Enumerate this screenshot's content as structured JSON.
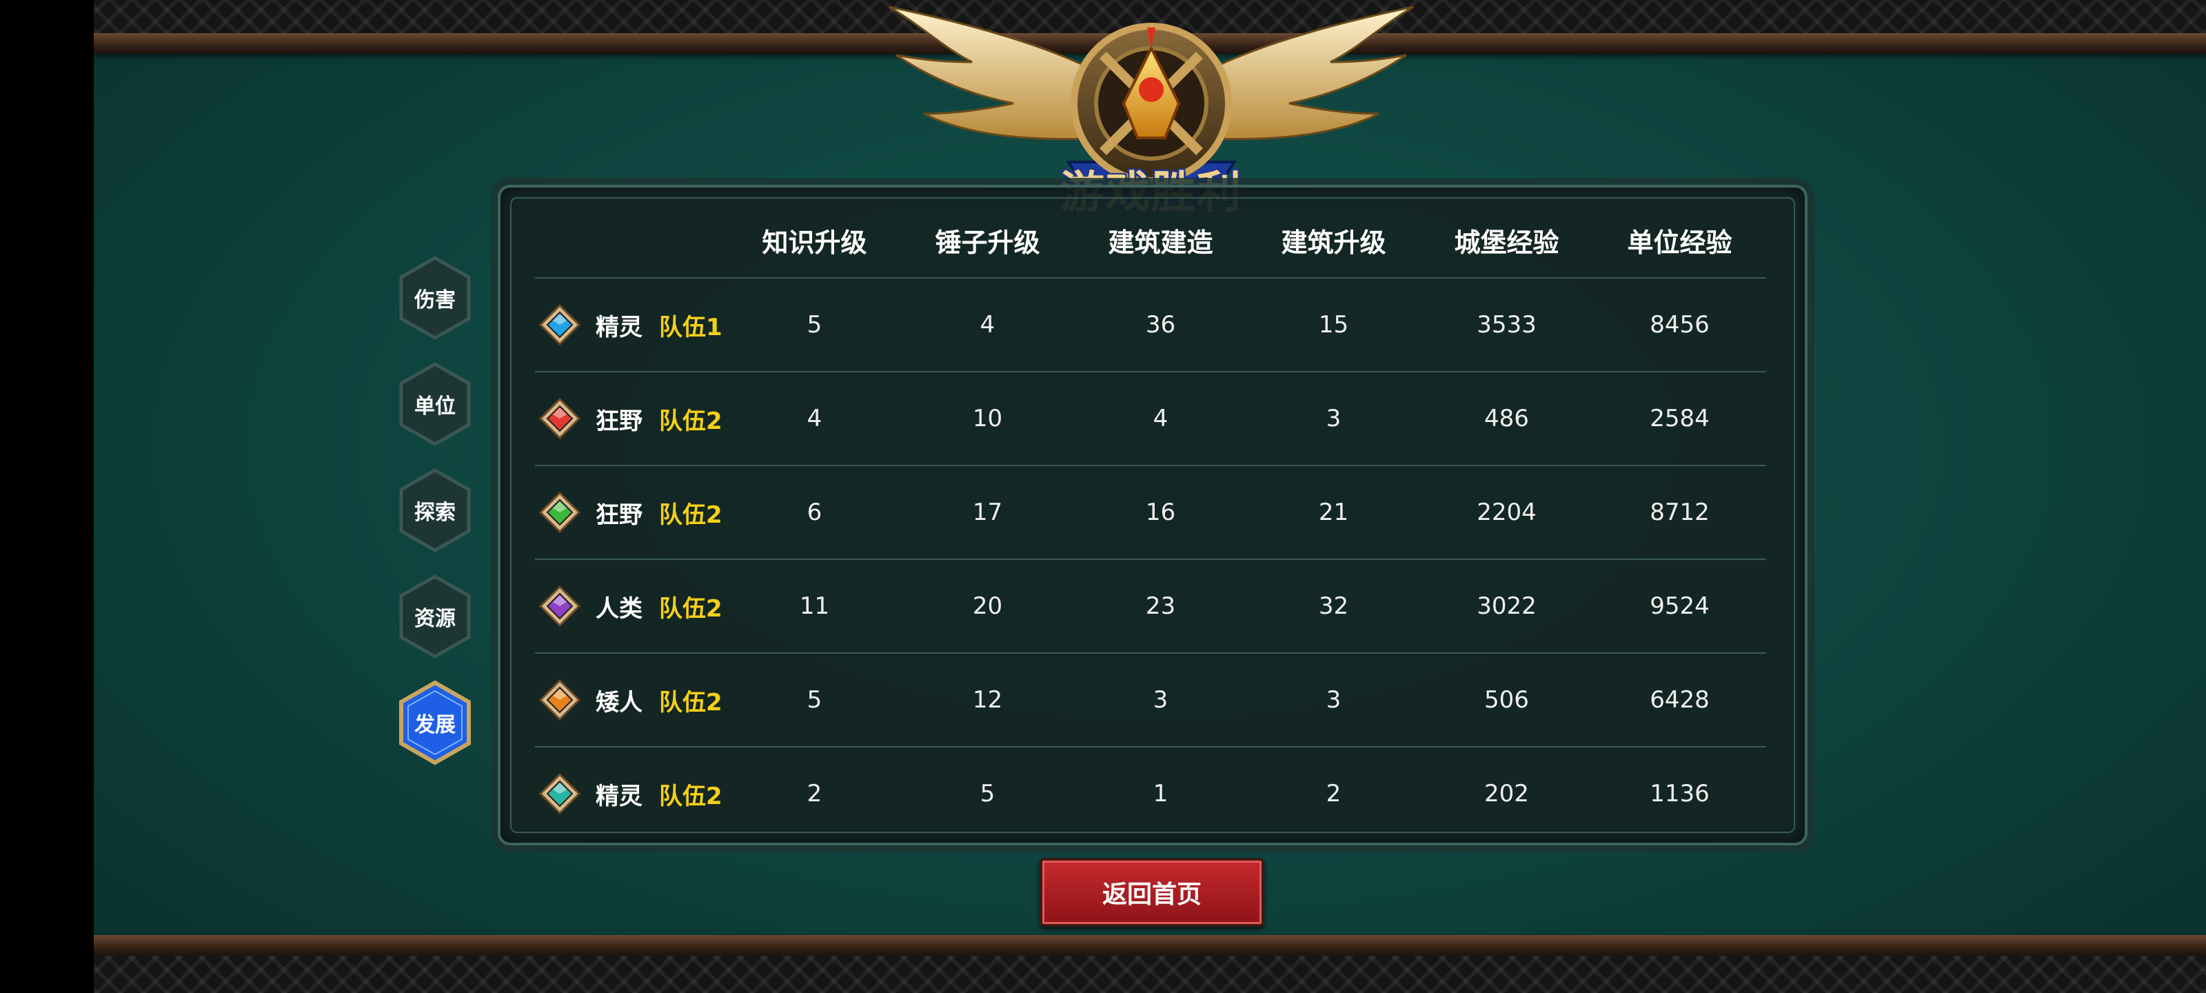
{
  "title": "游戏胜利",
  "tabs": [
    {
      "label": "伤害",
      "active": false
    },
    {
      "label": "单位",
      "active": false
    },
    {
      "label": "探索",
      "active": false
    },
    {
      "label": "资源",
      "active": false
    },
    {
      "label": "发展",
      "active": true
    }
  ],
  "table": {
    "columns": [
      "知识升级",
      "锤子升级",
      "建筑建造",
      "建筑升级",
      "城堡经验",
      "单位经验"
    ],
    "rows": [
      {
        "gem": "blue-gem-icon",
        "gem_color": "#1ea3e6",
        "race": "精灵",
        "team": "队伍1",
        "values": [
          "5",
          "4",
          "36",
          "15",
          "3533",
          "8456"
        ]
      },
      {
        "gem": "red-gem-icon",
        "gem_color": "#e23a2f",
        "race": "狂野",
        "team": "队伍2",
        "values": [
          "4",
          "10",
          "4",
          "3",
          "486",
          "2584"
        ]
      },
      {
        "gem": "green-gem-icon",
        "gem_color": "#3cb83a",
        "race": "狂野",
        "team": "队伍2",
        "values": [
          "6",
          "17",
          "16",
          "21",
          "2204",
          "8712"
        ]
      },
      {
        "gem": "purple-gem-icon",
        "gem_color": "#8e3fc4",
        "race": "人类",
        "team": "队伍2",
        "values": [
          "11",
          "20",
          "23",
          "32",
          "3022",
          "9524"
        ]
      },
      {
        "gem": "orange-gem-icon",
        "gem_color": "#e9821b",
        "race": "矮人",
        "team": "队伍2",
        "values": [
          "5",
          "12",
          "3",
          "3",
          "506",
          "6428"
        ]
      },
      {
        "gem": "teal-gem-icon",
        "gem_color": "#2bb4a4",
        "race": "精灵",
        "team": "队伍2",
        "values": [
          "2",
          "5",
          "1",
          "2",
          "202",
          "1136"
        ]
      }
    ]
  },
  "return_button": "返回首页",
  "colors": {
    "team_text": "#f5d019",
    "active_tab": "#1f5fe6",
    "button_red": "#b81f24",
    "background": "#0f4641"
  }
}
